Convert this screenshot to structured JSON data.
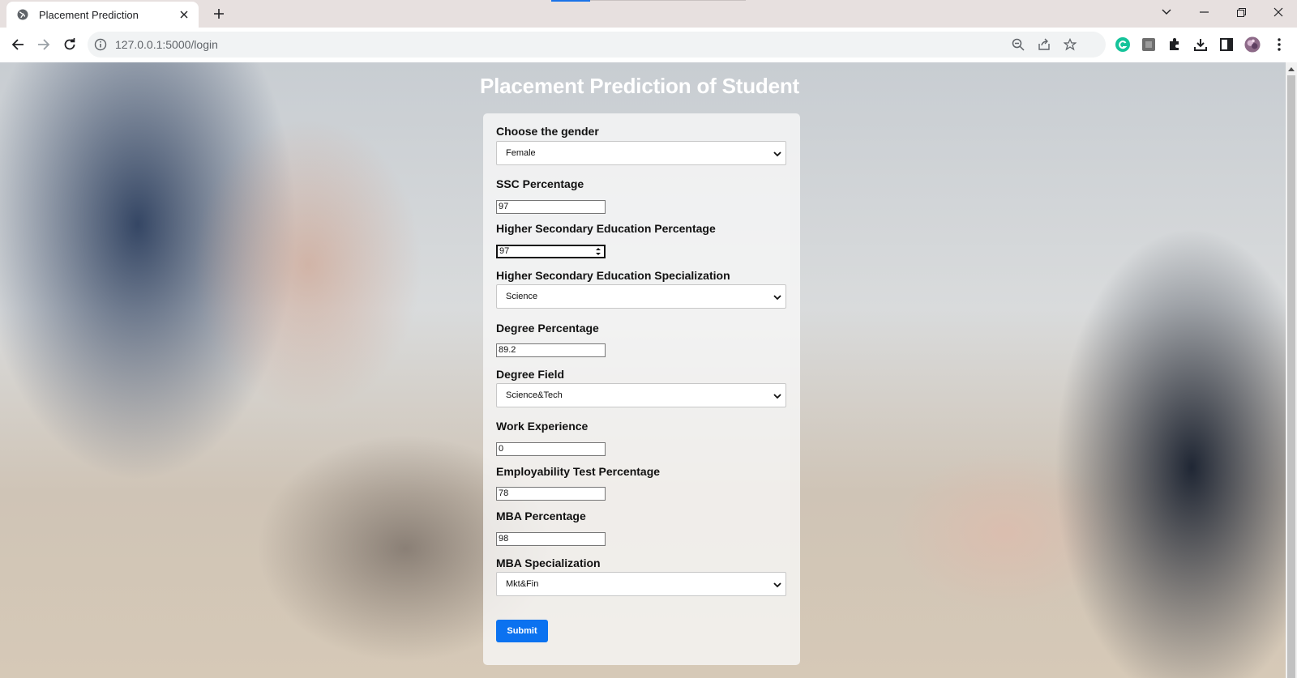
{
  "browser": {
    "tab_title": "Placement Prediction",
    "url": "127.0.0.1:5000/login"
  },
  "page": {
    "title": "Placement Prediction of Student"
  },
  "form": {
    "gender": {
      "label": "Choose the gender",
      "value": "Female"
    },
    "ssc": {
      "label": "SSC Percentage",
      "value": "97"
    },
    "hsc": {
      "label": "Higher Secondary Education Percentage",
      "value": "97"
    },
    "hsc_spec": {
      "label": "Higher Secondary Education Specialization",
      "value": "Science"
    },
    "degree": {
      "label": "Degree Percentage",
      "value": "89.2"
    },
    "degree_field": {
      "label": "Degree Field",
      "value": "Science&Tech"
    },
    "work_exp": {
      "label": "Work Experience",
      "value": "0"
    },
    "etest": {
      "label": "Employability Test Percentage",
      "value": "78"
    },
    "mba": {
      "label": "MBA Percentage",
      "value": "98"
    },
    "mba_spec": {
      "label": "MBA Specialization",
      "value": "Mkt&Fin"
    },
    "submit_label": "Submit"
  },
  "colors": {
    "submit": "#0b72f0",
    "grammarly": "#15c39a",
    "tab_indicator": "#1a73e8"
  }
}
